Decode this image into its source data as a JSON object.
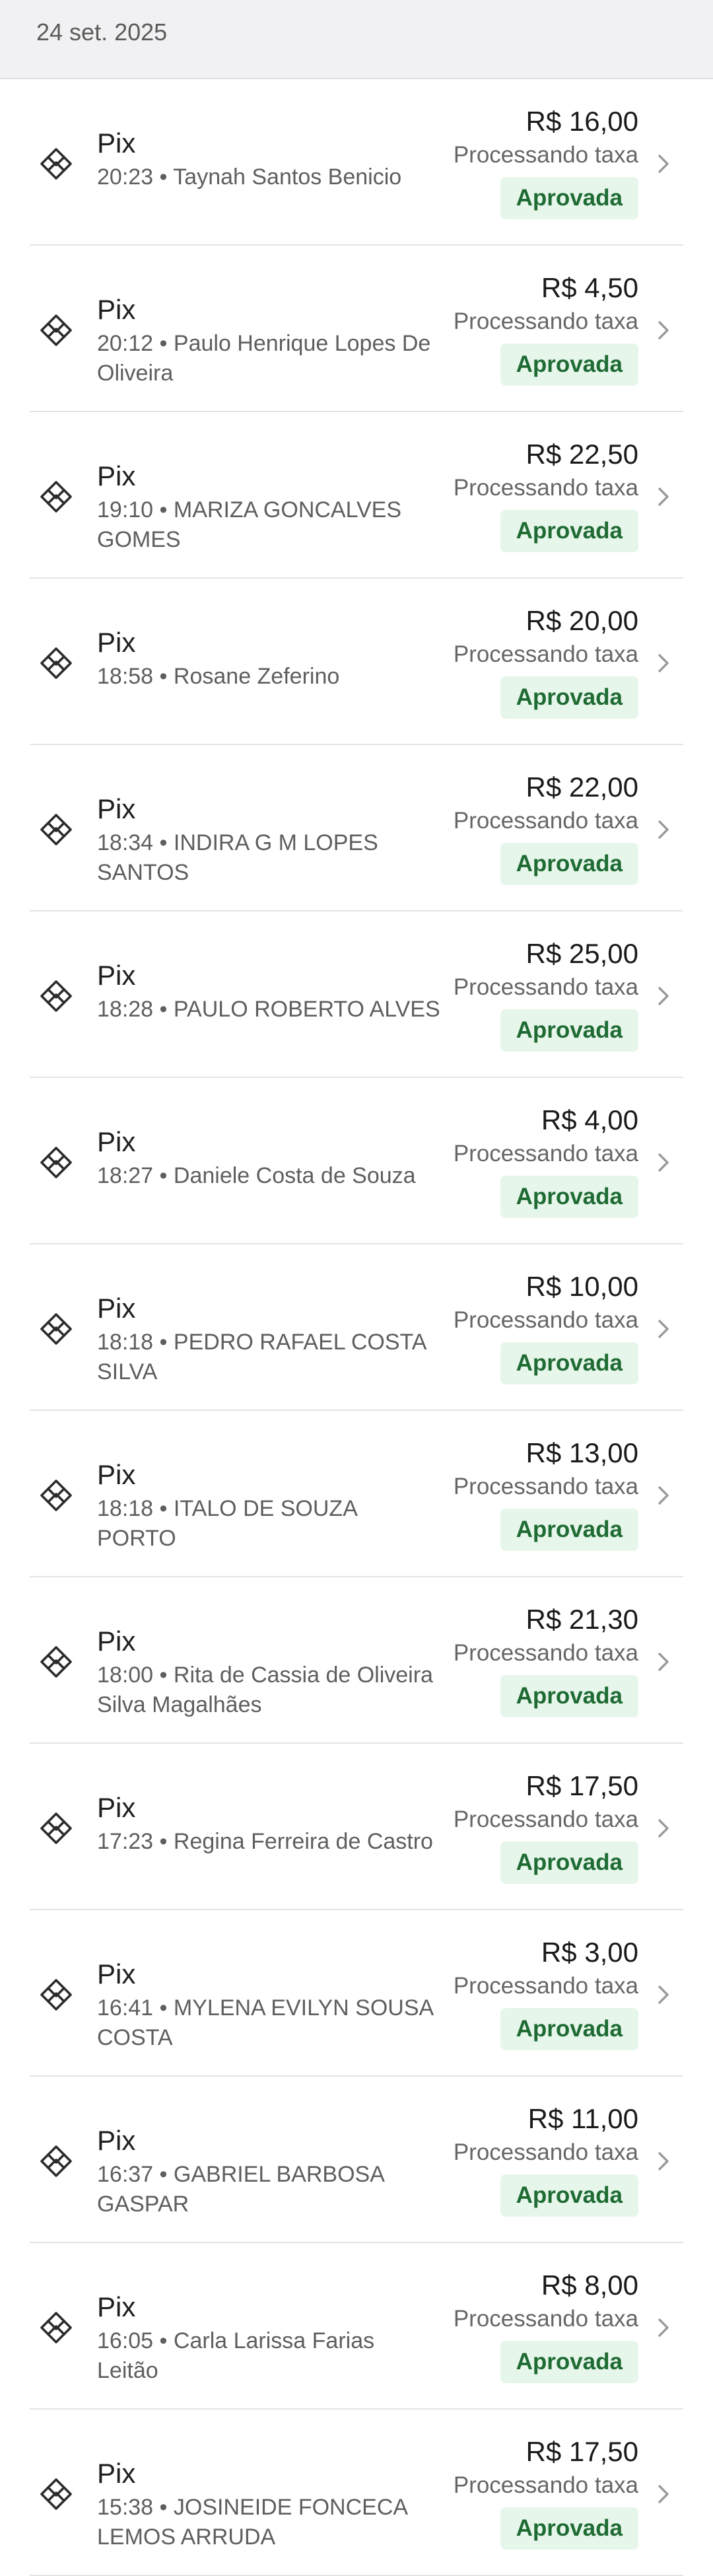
{
  "date_header": "24 set. 2025",
  "transactions": [
    {
      "method": "Pix",
      "time": "20:23",
      "name": "Taynah Santos Benicio",
      "amount": "R$ 16,00",
      "fee_status": "Processando taxa",
      "status": "Aprovada"
    },
    {
      "method": "Pix",
      "time": "20:12",
      "name": "Paulo Henrique Lopes De Oliveira",
      "amount": "R$ 4,50",
      "fee_status": "Processando taxa",
      "status": "Aprovada"
    },
    {
      "method": "Pix",
      "time": "19:10",
      "name": "MARIZA GONCALVES GOMES",
      "amount": "R$ 22,50",
      "fee_status": "Processando taxa",
      "status": "Aprovada"
    },
    {
      "method": "Pix",
      "time": "18:58",
      "name": "Rosane Zeferino",
      "amount": "R$ 20,00",
      "fee_status": "Processando taxa",
      "status": "Aprovada"
    },
    {
      "method": "Pix",
      "time": "18:34",
      "name": "INDIRA G M LOPES SANTOS",
      "amount": "R$ 22,00",
      "fee_status": "Processando taxa",
      "status": "Aprovada"
    },
    {
      "method": "Pix",
      "time": "18:28",
      "name": "PAULO ROBERTO ALVES",
      "amount": "R$ 25,00",
      "fee_status": "Processando taxa",
      "status": "Aprovada"
    },
    {
      "method": "Pix",
      "time": "18:27",
      "name": "Daniele Costa de Souza",
      "amount": "R$ 4,00",
      "fee_status": "Processando taxa",
      "status": "Aprovada"
    },
    {
      "method": "Pix",
      "time": "18:18",
      "name": "PEDRO RAFAEL COSTA SILVA",
      "amount": "R$ 10,00",
      "fee_status": "Processando taxa",
      "status": "Aprovada"
    },
    {
      "method": "Pix",
      "time": "18:18",
      "name": "ITALO DE SOUZA PORTO",
      "amount": "R$ 13,00",
      "fee_status": "Processando taxa",
      "status": "Aprovada"
    },
    {
      "method": "Pix",
      "time": "18:00",
      "name": "Rita de Cassia de Oliveira Silva Magalhães",
      "amount": "R$ 21,30",
      "fee_status": "Processando taxa",
      "status": "Aprovada"
    },
    {
      "method": "Pix",
      "time": "17:23",
      "name": "Regina Ferreira de Castro",
      "amount": "R$ 17,50",
      "fee_status": "Processando taxa",
      "status": "Aprovada"
    },
    {
      "method": "Pix",
      "time": "16:41",
      "name": "MYLENA EVILYN SOUSA COSTA",
      "amount": "R$ 3,00",
      "fee_status": "Processando taxa",
      "status": "Aprovada"
    },
    {
      "method": "Pix",
      "time": "16:37",
      "name": "GABRIEL BARBOSA GASPAR",
      "amount": "R$ 11,00",
      "fee_status": "Processando taxa",
      "status": "Aprovada"
    },
    {
      "method": "Pix",
      "time": "16:05",
      "name": "Carla Larissa Farias Leitão",
      "amount": "R$ 8,00",
      "fee_status": "Processando taxa",
      "status": "Aprovada"
    },
    {
      "method": "Pix",
      "time": "15:38",
      "name": "JOSINEIDE FONCECA LEMOS ARRUDA",
      "amount": "R$ 17,50",
      "fee_status": "Processando taxa",
      "status": "Aprovada"
    }
  ],
  "icons": {
    "method": "pix-icon",
    "chevron": "chevron-right-icon"
  },
  "colors": {
    "badge_bg": "#e6f6ea",
    "badge_text": "#1f6b34",
    "header_bg": "#f1f1f3"
  }
}
